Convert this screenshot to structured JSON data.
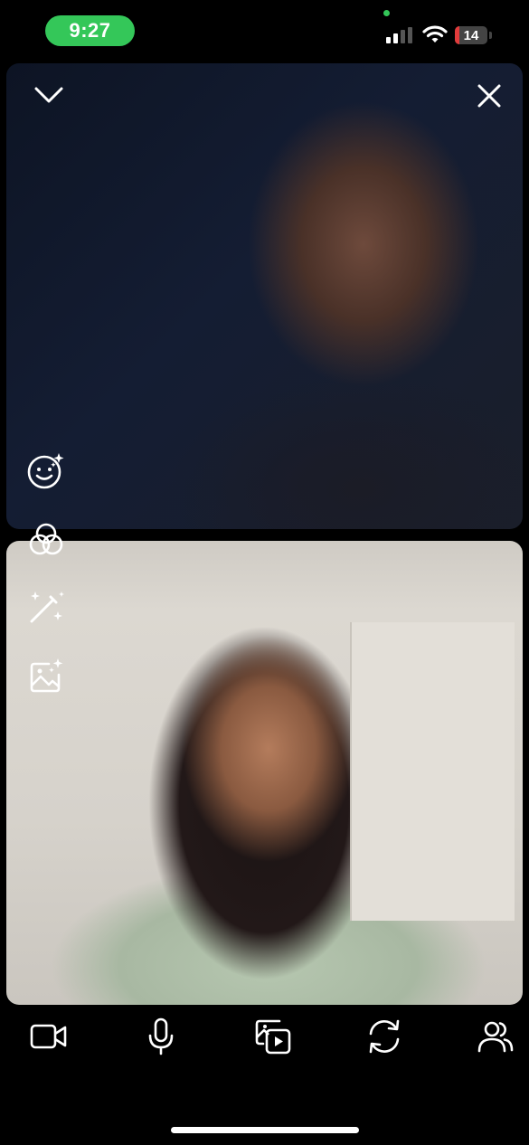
{
  "status_bar": {
    "time": "9:27",
    "battery_level": "14",
    "battery_fraction": 0.14
  },
  "call": {
    "remote_participant_video": "remote-video",
    "local_participant_video": "self-video",
    "top_left_icon": "chevron-down-icon",
    "top_right_icon": "close-icon"
  },
  "side_tools": [
    {
      "name": "face-effects",
      "icon": "smiley-sparkle-icon"
    },
    {
      "name": "filters",
      "icon": "overlapping-circles-icon"
    },
    {
      "name": "magic-wand",
      "icon": "magic-wand-icon"
    },
    {
      "name": "background",
      "icon": "image-sparkle-icon"
    }
  ],
  "bottom_bar": [
    {
      "name": "camera",
      "icon": "video-camera-icon"
    },
    {
      "name": "microphone",
      "icon": "microphone-icon"
    },
    {
      "name": "share-media",
      "icon": "media-share-icon"
    },
    {
      "name": "flip-camera",
      "icon": "flip-camera-icon"
    },
    {
      "name": "participants",
      "icon": "people-icon"
    }
  ],
  "colors": {
    "status_green": "#34c759",
    "battery_low": "#e23b3b",
    "icon_color": "#ffffff"
  }
}
